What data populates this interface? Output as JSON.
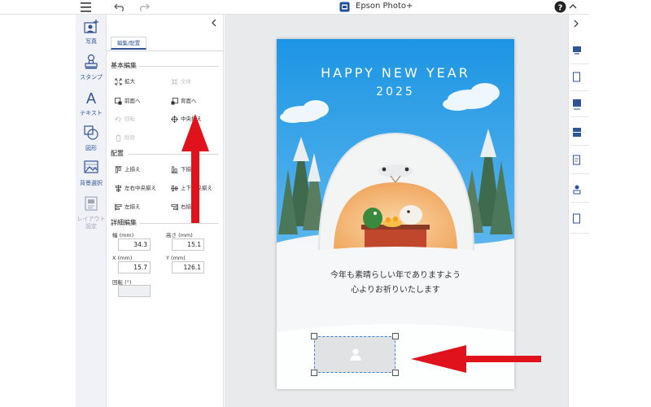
{
  "app": {
    "title": "Epson Photo+"
  },
  "rail": {
    "items": [
      {
        "label": "写真",
        "icon": "photo-add-icon",
        "disabled": false
      },
      {
        "label": "スタンプ",
        "icon": "stamp-icon",
        "disabled": false
      },
      {
        "label": "テキスト",
        "icon": "text-icon",
        "disabled": false
      },
      {
        "label": "図形",
        "icon": "shape-icon",
        "disabled": false
      },
      {
        "label": "背景選択",
        "icon": "background-icon",
        "disabled": false
      },
      {
        "label": "レイアウト設定",
        "icon": "layout-icon",
        "disabled": true
      }
    ]
  },
  "panel": {
    "tab": "編集/配置",
    "basic": {
      "title": "基本編集",
      "zoom": "拡大",
      "fit": "全体",
      "front": "前面へ",
      "back": "背面へ",
      "rotate": "回転",
      "center": "中央揃え",
      "delete": "削除"
    },
    "arrange": {
      "title": "配置",
      "top": "上揃え",
      "bottom": "下揃え",
      "lr_center": "左右中央揃え",
      "tb_center": "上下中央揃え",
      "left": "左揃え",
      "right": "右揃え"
    },
    "detail": {
      "title": "詳細編集",
      "width_label": "幅 (mm)",
      "width": "34.3",
      "height_label": "高さ (mm)",
      "height": "15.1",
      "x_label": "X (mm)",
      "x": "15.7",
      "y_label": "Y (mm)",
      "y": "126.1",
      "rotation_label": "回転 (°)",
      "rotation": ""
    }
  },
  "card": {
    "headline": "HAPPY NEW YEAR",
    "year": "2025",
    "message_line1": "今年も素晴らしい年でありますよう",
    "message_line2": "心よりお祈りいたします"
  },
  "colors": {
    "accent": "#2f5597",
    "arrow": "#e0121b",
    "sky": "#2d9fe6",
    "selection": "#3d86d6"
  }
}
